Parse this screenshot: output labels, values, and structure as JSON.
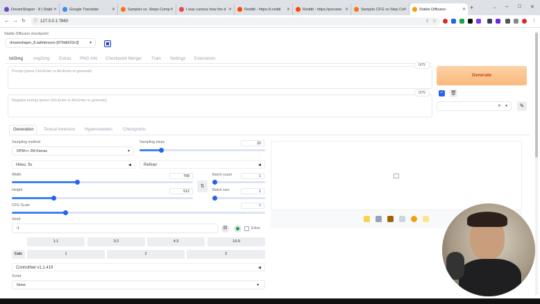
{
  "browser": {
    "tabs": [
      {
        "title": "DreamShaper - 8 | Stabl",
        "color": "#6b46c1"
      },
      {
        "title": "Google Translate",
        "color": "#4285f4"
      },
      {
        "title": "Sampler vs. Steps Comp",
        "color": "#f97316"
      },
      {
        "title": "I was curious how the d",
        "color": "#ef4444"
      },
      {
        "title": "Reddit - https://i.reddi",
        "color": "#ff4500"
      },
      {
        "title": "Reddit - https://preview",
        "color": "#ff4500"
      },
      {
        "title": "Sampler CFG vs Step Co",
        "color": "#f97316"
      },
      {
        "title": "Stable Diffusion",
        "color": "#f59e0b"
      }
    ],
    "url": "127.0.0.1:7860"
  },
  "app": {
    "checkpoint_label": "Stable Diffusion checkpoint",
    "checkpoint_value": "dreamshaper_8.safetensors [879db523c3]",
    "main_tabs": [
      "txt2img",
      "img2img",
      "Extras",
      "PNG Info",
      "Checkpoint Merger",
      "Train",
      "Settings",
      "Extensions"
    ],
    "prompt_placeholder": "Prompt (press Ctrl+Enter or Alt+Enter to generate)",
    "prompt_counter": "0/75",
    "neg_placeholder": "Negative prompt (press Ctrl+Enter or Alt+Enter to generate)",
    "neg_counter": "0/75",
    "generate_label": "Generate",
    "sub_tabs": [
      "Generation",
      "Textual Inversion",
      "Hypernetworks",
      "Checkpoints"
    ],
    "sampling_method_label": "Sampling method",
    "sampling_method_value": "DPM++ 2M Karras",
    "sampling_steps_label": "Sampling steps",
    "sampling_steps_value": "20",
    "sampling_steps_fraction": 0.17,
    "hires_label": "Hires. fix",
    "refiner_label": "Refiner",
    "width_label": "Width",
    "width_value": "768",
    "width_fraction": 0.36,
    "height_label": "Height",
    "height_value": "512",
    "height_fraction": 0.23,
    "batch_count_label": "Batch count",
    "batch_count_value": "1",
    "batch_size_label": "Batch size",
    "batch_size_value": "1",
    "cfg_label": "CFG Scale",
    "cfg_value": "7",
    "cfg_fraction": 0.21,
    "seed_label": "Seed",
    "seed_value": "-1",
    "extra_label": "Extra",
    "ratios": [
      "1:1",
      "3:2",
      "4:3",
      "16:9"
    ],
    "calc_label": "Calc",
    "multipliers": [
      "1",
      "2",
      "3"
    ],
    "controlnet_label": "ControlNet v1.1.419",
    "script_label": "Script",
    "script_value": "None"
  }
}
